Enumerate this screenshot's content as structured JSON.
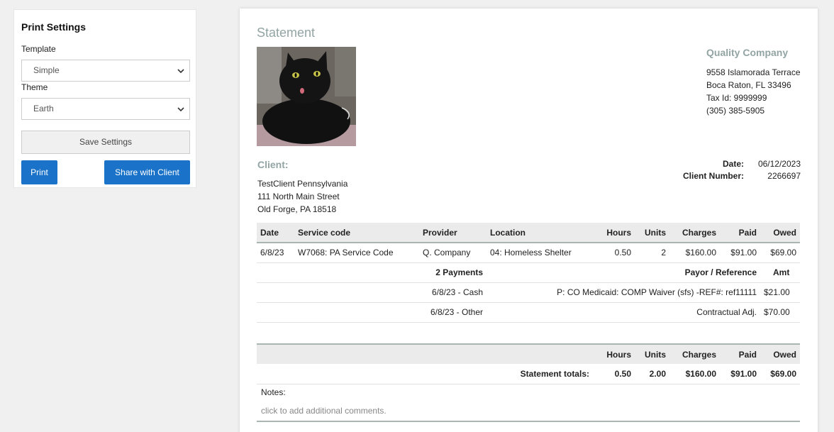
{
  "settings": {
    "title": "Print Settings",
    "template_label": "Template",
    "template_value": "Simple",
    "theme_label": "Theme",
    "theme_value": "Earth",
    "save_label": "Save Settings",
    "print_label": "Print",
    "share_label": "Share with Client",
    "accent_color": "#1a73c9"
  },
  "statement": {
    "title": "Statement",
    "company": {
      "name": "Quality Company",
      "address1": "9558 Islamorada Terrace",
      "address2": "Boca Raton, FL 33496",
      "tax_id": "Tax Id: 9999999",
      "phone": "(305) 385-5905"
    },
    "client": {
      "label": "Client:",
      "name": "TestClient Pennsylvania",
      "address1": "111 North Main Street",
      "address2": "Old Forge, PA 18518"
    },
    "meta": {
      "date_label": "Date:",
      "date_value": "06/12/2023",
      "client_number_label": "Client Number:",
      "client_number_value": "2266697"
    },
    "columns": {
      "date": "Date",
      "service_code": "Service code",
      "provider": "Provider",
      "location": "Location",
      "hours": "Hours",
      "units": "Units",
      "charges": "Charges",
      "paid": "Paid",
      "owed": "Owed"
    },
    "service_row": {
      "date": "6/8/23",
      "service_code": "W7068: PA Service Code",
      "provider": "Q. Company",
      "location": "04: Homeless Shelter",
      "hours": "0.50",
      "units": "2",
      "charges": "$160.00",
      "paid": "$91.00",
      "owed": "$69.00"
    },
    "payments": {
      "header": "2 Payments",
      "payor_header": "Payor / Reference",
      "amt_header": "Amt",
      "rows": [
        {
          "label": "6/8/23 - Cash",
          "payor": "P: CO Medicaid: COMP Waiver (sfs) -REF#: ref11111",
          "amt": "$21.00"
        },
        {
          "label": "6/8/23 - Other",
          "payor": "Contractual Adj.",
          "amt": "$70.00"
        }
      ]
    },
    "totals": {
      "label": "Statement totals:",
      "hours": "0.50",
      "units": "2.00",
      "charges": "$160.00",
      "paid": "$91.00",
      "owed": "$69.00"
    },
    "notes": {
      "label": "Notes:",
      "placeholder": "click to add additional comments."
    }
  }
}
